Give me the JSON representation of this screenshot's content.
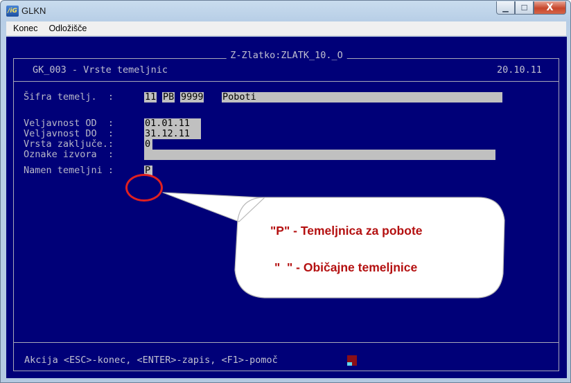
{
  "window": {
    "title": "GLKN",
    "icon_text": "/iG",
    "minimize_glyph": "▁",
    "maximize_glyph": "☐",
    "close_glyph": "X"
  },
  "menu": [
    "Konec",
    "Odložišče"
  ],
  "console": {
    "frame_title": "Z-Zlatko:ZLATK_10._O",
    "screen_title": "GK_003 - Vrste temeljnic",
    "date": "20.10.11",
    "fields": {
      "sifra_label": "Šifra temelj.  :",
      "sifra_values": [
        "11",
        "PB",
        "9999",
        "Poboti"
      ],
      "od_label": "Veljavnost OD  :",
      "od_value": "01.01.11",
      "do_label": "Veljavnost DO  :",
      "do_value": "31.12.11",
      "zakljuce_label": "Vrsta zaključe.:",
      "zakljuce_value": "0",
      "izvora_label": "Oznake izvora  :",
      "izvora_value": "",
      "namen_label": "Namen temeljni :",
      "namen_value": "P"
    },
    "footer": "Akcija <ESC>-konec, <ENTER>-zapis, <F1>-pomoč"
  },
  "callout": {
    "line1": "\"P\" - Temeljnica za pobote",
    "line2": "\"  \" - Običajne temeljnice",
    "color": "#b41010"
  },
  "colors": {
    "console_bg": "#000078",
    "field_bg": "#c0c0c0",
    "annotation_red": "#e02020"
  }
}
